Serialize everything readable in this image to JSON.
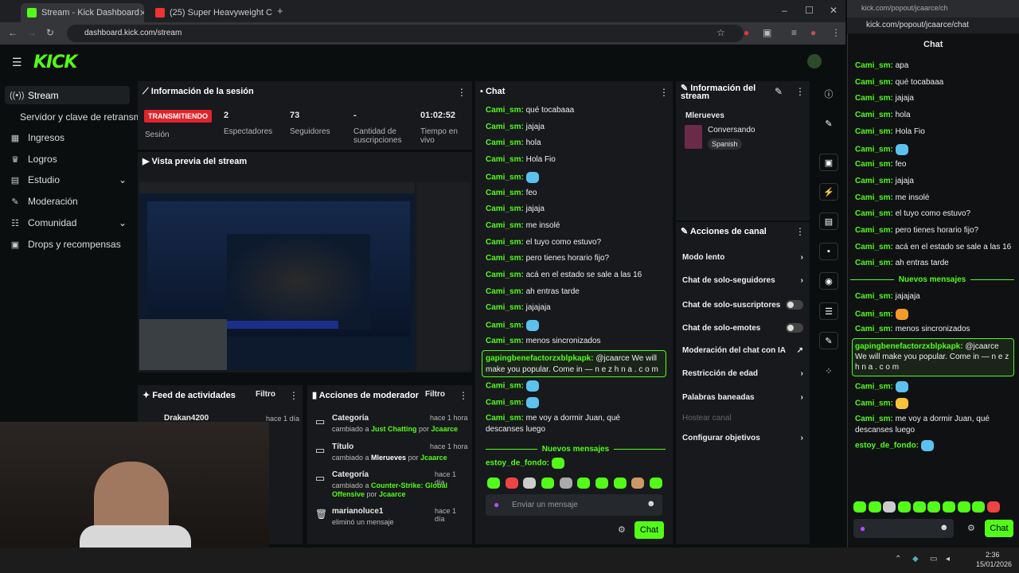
{
  "browser": {
    "tabs": [
      {
        "label": "Stream - Kick Dashboard"
      },
      {
        "label": "(25) Super Heavyweight Co"
      }
    ],
    "url": "dashboard.kick.com/stream",
    "popup_url": "kick.com/popout/jcaarce/chat",
    "popup_tab": "kick.com/popout/jcaarce/ch"
  },
  "sidebar": {
    "items": [
      {
        "label": "Stream"
      },
      {
        "label": "Servidor y clave de retransm"
      },
      {
        "label": "Ingresos"
      },
      {
        "label": "Logros"
      },
      {
        "label": "Estudio"
      },
      {
        "label": "Moderación"
      },
      {
        "label": "Comunidad"
      },
      {
        "label": "Drops y recompensas"
      }
    ]
  },
  "session": {
    "title": "Información de la sesión",
    "status": "TRANSMITIENDO",
    "status_label": "Sesión",
    "stats": [
      {
        "value": "2",
        "label": "Espectadores"
      },
      {
        "value": "73",
        "label": "Seguidores"
      },
      {
        "value": "-",
        "label": "Cantidad de suscripciones"
      },
      {
        "value": "01:02:52",
        "label": "Tiempo en vivo"
      }
    ]
  },
  "preview": {
    "title": "Vista previa del stream"
  },
  "activity": {
    "title": "Feed de actividades",
    "filter": "Filtro",
    "entry": "Drakan4200",
    "entry_time": "hace 1 día"
  },
  "modactions": {
    "title": "Acciones de moderador",
    "filter": "Filtro",
    "items": [
      {
        "title": "Categoría",
        "time": "hace 1 hora",
        "pre": "cambiado a ",
        "val": "Just Chatting",
        "by": " por ",
        "user": "Jcaarce"
      },
      {
        "title": "Título",
        "time": "hace 1 hora",
        "pre": "cambiado a ",
        "val": "Mlerueves",
        "by": " por ",
        "user": "Jcaarce"
      },
      {
        "title": "Categoría",
        "time": "hace 1 día",
        "pre": "cambiado a ",
        "val": "Counter-Strike: Global Offensive",
        "by": " por ",
        "user": "Jcaarce"
      },
      {
        "title": "marianoluce1",
        "time": "hace 1 día",
        "pre": "eliminó un mensaje",
        "val": "",
        "by": "",
        "user": ""
      }
    ]
  },
  "chat": {
    "title": "Chat",
    "new_messages": "Nuevos mensajes",
    "placeholder": "Enviar un mensaje",
    "send": "Chat",
    "messages": [
      {
        "user": "Cami_sm:",
        "text": "qué tocabaaa"
      },
      {
        "user": "Cami_sm:",
        "text": "jajaja"
      },
      {
        "user": "Cami_sm:",
        "text": "hola"
      },
      {
        "user": "Cami_sm:",
        "text": "Hola Fio"
      },
      {
        "user": "Cami_sm:",
        "text": ""
      },
      {
        "user": "Cami_sm:",
        "text": "feo"
      },
      {
        "user": "Cami_sm:",
        "text": "jajaja"
      },
      {
        "user": "Cami_sm:",
        "text": "me insolé"
      },
      {
        "user": "Cami_sm:",
        "text": "el tuyo como estuvo?"
      },
      {
        "user": "Cami_sm:",
        "text": "pero tienes horario fijo?"
      },
      {
        "user": "Cami_sm:",
        "text": "acá en el estado se sale a las 16"
      },
      {
        "user": "Cami_sm:",
        "text": "ah entras tarde"
      },
      {
        "user": "Cami_sm:",
        "text": "jajajaja"
      },
      {
        "user": "Cami_sm:",
        "text": ""
      },
      {
        "user": "Cami_sm:",
        "text": "menos sincronizados"
      }
    ],
    "spam_user": "gapingbenefactorzxblpkapk:",
    "spam_text": "@jcaarce We will make you popular. Come in — n e z h n a . c o m",
    "after": [
      {
        "user": "Cami_sm:",
        "text": ""
      },
      {
        "user": "Cami_sm:",
        "text": ""
      },
      {
        "user": "Cami_sm:",
        "text": "me voy a dormir Juan, qué descanses luego"
      }
    ],
    "last_user": "estoy_de_fondo:"
  },
  "streaminfo": {
    "title": "Información del stream",
    "name": "Mlerueves",
    "category": "Conversando",
    "lang": "Spanish"
  },
  "channel": {
    "title": "Acciones de canal",
    "items": [
      {
        "label": "Modo lento"
      },
      {
        "label": "Chat de solo-seguidores"
      },
      {
        "label": "Chat de solo-suscriptores"
      },
      {
        "label": "Chat de solo-emotes"
      },
      {
        "label": "Moderación del chat con IA"
      },
      {
        "label": "Restricción de edad"
      },
      {
        "label": "Palabras baneadas"
      },
      {
        "label": "Hostear canal"
      },
      {
        "label": "Configurar objetivos"
      }
    ]
  },
  "popout": {
    "title": "Chat",
    "messages": [
      {
        "user": "Cami_sm:",
        "text": "apa"
      },
      {
        "user": "Cami_sm:",
        "text": "qué tocabaaa"
      },
      {
        "user": "Cami_sm:",
        "text": "jajaja"
      },
      {
        "user": "Cami_sm:",
        "text": "hola"
      },
      {
        "user": "Cami_sm:",
        "text": "Hola Fio"
      },
      {
        "user": "Cami_sm:",
        "text": ""
      },
      {
        "user": "Cami_sm:",
        "text": "feo"
      },
      {
        "user": "Cami_sm:",
        "text": "jajaja"
      },
      {
        "user": "Cami_sm:",
        "text": "me insolé"
      },
      {
        "user": "Cami_sm:",
        "text": "el tuyo como estuvo?"
      },
      {
        "user": "Cami_sm:",
        "text": "pero tienes horario fijo?"
      },
      {
        "user": "Cami_sm:",
        "text": "acá en el estado se sale a las 16"
      },
      {
        "user": "Cami_sm:",
        "text": "ah entras tarde"
      }
    ],
    "new_messages": "Nuevos mensajes",
    "after": [
      {
        "user": "Cami_sm:",
        "text": "jajajaja"
      },
      {
        "user": "Cami_sm:",
        "text": ""
      },
      {
        "user": "Cami_sm:",
        "text": "menos sincronizados"
      }
    ],
    "spam_user": "gapingbenefactorzxblpkapk:",
    "spam_text": "@jcaarce We will make you popular. Come in — n e z h n a . c o m",
    "after2": [
      {
        "user": "Cami_sm:",
        "text": ""
      },
      {
        "user": "Cami_sm:",
        "text": ""
      },
      {
        "user": "Cami_sm:",
        "text": "me voy a dormir Juan, qué descanses luego"
      },
      {
        "user": "estoy_de_fondo:",
        "text": ""
      }
    ],
    "send": "Chat"
  },
  "taskbar": {
    "time": "2:36",
    "date": "15/01/2026"
  }
}
